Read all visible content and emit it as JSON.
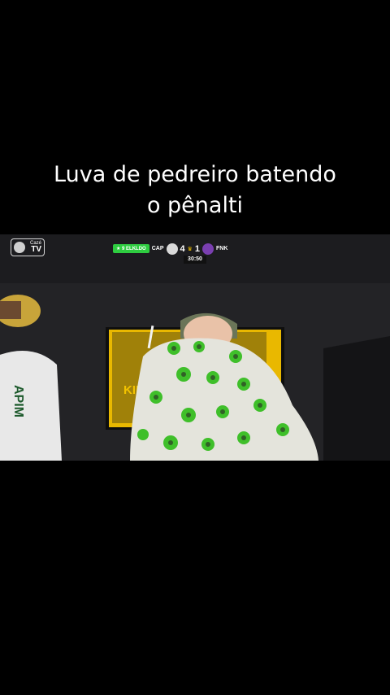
{
  "caption": {
    "line1": "Luva de pedreiro batendo",
    "line2": "o pênalti"
  },
  "overlay": {
    "channel_small": "Cazé",
    "channel_big": "TV",
    "live_tag": "★ 9 ELKLDO",
    "home_team": "CAP",
    "home_score": "4",
    "away_score": "1",
    "away_team": "FNK",
    "clock": "30:50"
  },
  "scene": {
    "jersey_text": "APIM",
    "screen_text": "KIN"
  },
  "colors": {
    "accent_yellow": "#f2c200",
    "live_green": "#2ecc40",
    "dress_green": "#3fbf2a"
  }
}
